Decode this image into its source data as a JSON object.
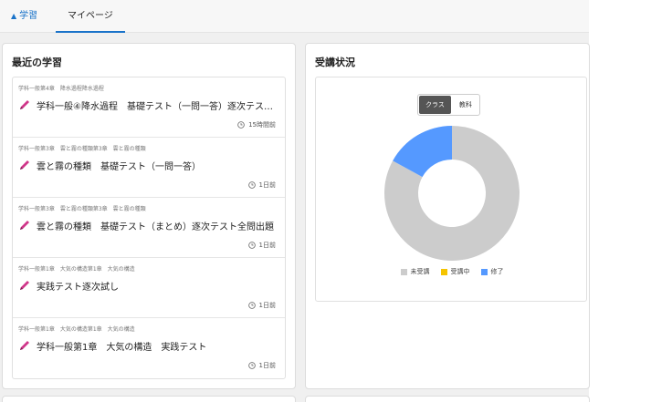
{
  "nav": {
    "study_label": "学習",
    "mypage_label": "マイページ"
  },
  "recent": {
    "title": "最近の学習",
    "items": [
      {
        "crumb": "学科一般第4章　降水過程降水過程",
        "title": "学科一般④降水過程　基礎テスト（一問一答）逐次テス…",
        "time": "15時間前"
      },
      {
        "crumb": "学科一般第3章　雲と霧の種類第3章　雲と霧の種類",
        "title": "雲と霧の種類　基礎テスト（一問一答）",
        "time": "1日前"
      },
      {
        "crumb": "学科一般第3章　雲と霧の種類第3章　雲と霧の種類",
        "title": "雲と霧の種類　基礎テスト（まとめ）逐次テスト全問出題",
        "time": "1日前"
      },
      {
        "crumb": "学科一般第1章　大気の構造第1章　大気の構造",
        "title": "実践テスト逐次試し",
        "time": "1日前"
      },
      {
        "crumb": "学科一般第1章　大気の構造第1章　大気の構造",
        "title": "学科一般第1章　大気の構造　実践テスト",
        "time": "1日前"
      }
    ]
  },
  "status": {
    "title": "受講状況",
    "toggle": {
      "class_label": "クラス",
      "subject_label": "教科"
    }
  },
  "chart_data": {
    "type": "pie",
    "variant": "donut",
    "categories": [
      "未受講",
      "受講中",
      "修了"
    ],
    "values": [
      83,
      0,
      17
    ],
    "colors": [
      "#cccccc",
      "#f5c400",
      "#5599ff"
    ],
    "legend_position": "bottom"
  },
  "colors": {
    "accent": "#1a73c9",
    "toggle_active": "#555555",
    "not_started": "#cccccc",
    "in_progress": "#f5c400",
    "completed": "#5599ff"
  }
}
